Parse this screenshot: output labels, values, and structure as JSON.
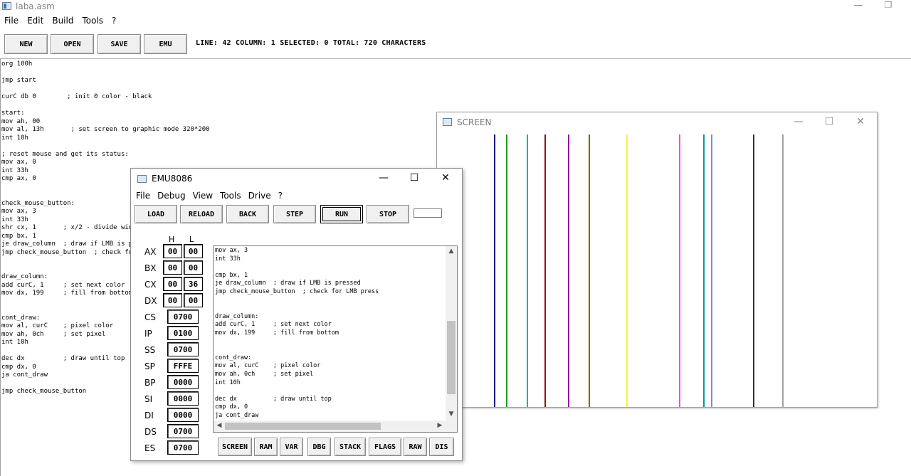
{
  "main_window": {
    "title": "laba.asm",
    "menu": [
      "File",
      "Edit",
      "Build",
      "Tools",
      "?"
    ],
    "toolbar": {
      "new": "NEW",
      "open": "OPEN",
      "save": "SAVE",
      "emu": "EMU"
    },
    "status": "LINE: 42  COLUMN: 1  SELECTED: 0  TOTAL: 720 CHARACTERS",
    "code": "org 100h\n\njmp start\n\ncurC db 0        ; init 0 color - black\n\nstart:\nmov ah, 00\nmov al, 13h       ; set screen to graphic mode 320*200\nint 10h\n\n; reset mouse and get its status:\nmov ax, 0\nint 33h\ncmp ax, 0\n\n\ncheck_mouse_button:\nmov ax, 3\nint 33h\nshr cx, 1       ; x/2 - divide width t\ncmp bx, 1\nje draw_column  ; draw if LMB is press\njmp check_mouse_button  ; check for LM\n\n\ndraw_column:\nadd curC, 1     ; set next color\nmov dx, 199     ; fill from bottom\n\n\ncont_draw:\nmov al, curC    ; pixel color\nmov ah, 0ch     ; set pixel\nint 10h\n\ndec dx          ; draw until top\ncmp dx, 0\nja cont_draw\n\njmp check_mouse_button"
  },
  "screen_window": {
    "title": "SCREEN",
    "line_colors": [
      "#00007f",
      "#1c9e1c",
      "#1fb2b2",
      "#8b1a1a",
      "#8b1a9b",
      "#9a5a00",
      "#f2f23a",
      "#ff40ff",
      "#009999",
      "#8080ff",
      "#333333",
      "#a0a0a0"
    ],
    "line_columns": [
      81,
      98,
      127,
      152,
      185,
      214,
      267,
      341,
      375,
      386,
      445,
      486
    ]
  },
  "emu_window": {
    "title": "EMU8086",
    "menu": [
      "File",
      "Debug",
      "View",
      "Tools",
      "Drive",
      "?"
    ],
    "toolbar": {
      "load": "LOAD",
      "reload": "RELOAD",
      "back": "BACK",
      "step": "STEP",
      "run": "RUN",
      "stop": "STOP"
    },
    "header_h": "H",
    "header_l": "L",
    "registers_hl": [
      {
        "name": "AX",
        "h": "00",
        "l": "00"
      },
      {
        "name": "BX",
        "h": "00",
        "l": "00"
      },
      {
        "name": "CX",
        "h": "00",
        "l": "36"
      },
      {
        "name": "DX",
        "h": "00",
        "l": "00"
      }
    ],
    "registers": [
      {
        "name": "CS",
        "value": "0700"
      },
      {
        "name": "IP",
        "value": "0100"
      },
      {
        "name": "SS",
        "value": "0700"
      },
      {
        "name": "SP",
        "value": "FFFE"
      },
      {
        "name": "BP",
        "value": "0000"
      },
      {
        "name": "SI",
        "value": "0000"
      },
      {
        "name": "DI",
        "value": "0000"
      },
      {
        "name": "DS",
        "value": "0700"
      },
      {
        "name": "ES",
        "value": "0700"
      }
    ],
    "code": "mov ax, 3\nint 33h\n\ncmp bx, 1\nje draw_column  ; draw if LMB is pressed\njmp check_mouse_button  ; check for LMB press\n\n\ndraw_column:\nadd curC, 1     ; set next color\nmov dx, 199     ; fill from bottom\n\n\ncont_draw:\nmov al, curC    ; pixel color\nmov ah, 0ch     ; set pixel\nint 10h\n\ndec dx          ; draw until top\ncmp dx, 0\nja cont_draw",
    "bottom_buttons": [
      "SCREEN",
      "RAM",
      "VAR",
      "DBG",
      "STACK",
      "FLAGS",
      "RAW",
      "DIS"
    ]
  }
}
